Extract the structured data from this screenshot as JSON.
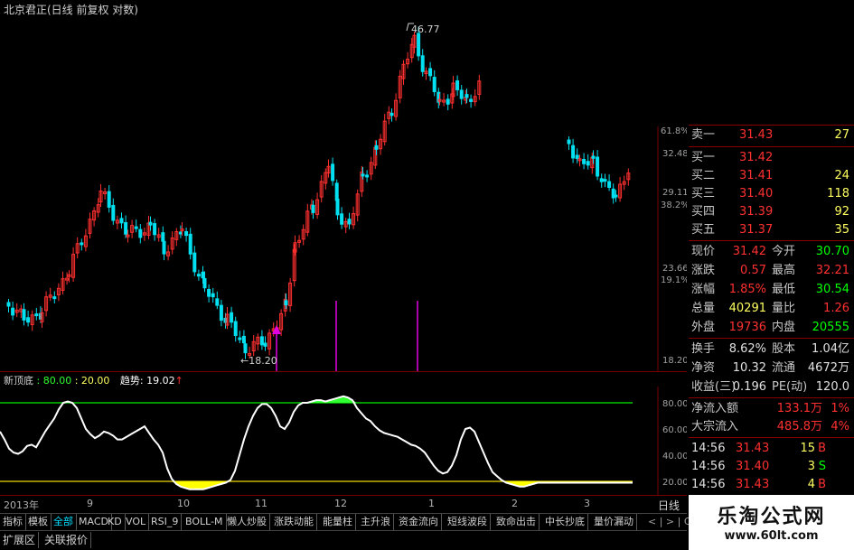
{
  "window": {
    "title": "北京君正(日线 前复权 对数)"
  },
  "price_chart": {
    "peak_label": "46.77",
    "low_label": "←18.20",
    "axis_labels": [
      "61.8%",
      "32.48",
      "29.11",
      "38.2%",
      "23.66",
      "19.1%",
      "18.20"
    ],
    "colors": {
      "up": "#ff3030",
      "down": "#00e0f0",
      "arrow": "#e000e0"
    }
  },
  "indicator": {
    "name": "新顶底",
    "line1": ": 80.00",
    "line2": ": 20.00",
    "trend_label": "趋势: 19.02",
    "trend_arrow": "↑",
    "axis_labels": [
      "80.00",
      "60.00",
      "40.00",
      "20.00"
    ],
    "colors": {
      "top_fill": "#30ff30",
      "bottom_fill": "#ffff00",
      "upper_line": "#00c800",
      "lower_line": "#c8b400"
    }
  },
  "time_axis": {
    "labels": [
      "2013年",
      "9",
      "10",
      "11",
      "12",
      "1",
      "2",
      "3"
    ]
  },
  "chart_data": {
    "type": "line",
    "x": [
      0,
      5,
      10,
      15,
      20,
      25,
      30,
      35,
      40,
      45,
      50,
      55,
      60,
      65,
      70,
      75,
      80,
      85,
      90,
      95,
      100,
      105,
      110,
      115,
      120,
      125,
      130,
      135,
      140,
      145,
      150,
      155,
      160,
      165,
      170,
      175,
      180,
      185,
      190,
      195,
      200,
      205,
      210,
      215,
      220,
      225,
      230,
      235,
      240,
      245,
      250,
      255,
      260,
      265,
      270,
      275,
      280,
      285,
      290,
      295,
      300,
      305,
      310,
      315,
      320,
      325,
      330,
      335,
      340,
      345,
      350,
      355,
      360,
      365,
      370,
      375,
      380,
      385,
      390,
      395,
      400,
      405,
      410,
      415,
      420,
      425,
      430,
      435,
      440,
      445,
      450,
      455,
      460,
      465,
      470,
      475,
      480,
      485,
      490,
      495,
      500,
      505,
      510,
      515,
      520,
      525,
      530,
      535,
      540,
      545,
      550,
      555,
      560,
      565,
      570,
      575,
      580,
      585,
      590,
      595,
      600,
      605,
      610,
      615,
      620,
      625,
      630,
      635,
      640,
      645,
      650,
      655,
      660,
      665,
      670,
      675,
      680,
      685,
      690,
      695,
      700
    ],
    "values": [
      58,
      52,
      45,
      42,
      41,
      43,
      47,
      48,
      46,
      52,
      58,
      63,
      68,
      75,
      80,
      81,
      80,
      76,
      68,
      60,
      56,
      53,
      55,
      58,
      57,
      55,
      52,
      52,
      54,
      56,
      58,
      60,
      62,
      57,
      52,
      48,
      42,
      30,
      22,
      18,
      16,
      15,
      14,
      14,
      14,
      14,
      15,
      16,
      17,
      18,
      19,
      21,
      28,
      40,
      52,
      62,
      70,
      76,
      79,
      79,
      76,
      70,
      62,
      60,
      65,
      73,
      78,
      80,
      80,
      81,
      82,
      82,
      81,
      82,
      83,
      84,
      85,
      84,
      82,
      76,
      72,
      68,
      66,
      62,
      59,
      57,
      56,
      55,
      54,
      52,
      50,
      48,
      47,
      45,
      42,
      37,
      32,
      28,
      26,
      27,
      32,
      40,
      52,
      60,
      61,
      58,
      50,
      42,
      34,
      27,
      24,
      21,
      19,
      18,
      17,
      16,
      16,
      17,
      18,
      19,
      19,
      19,
      19,
      19,
      19,
      19,
      19,
      19,
      19,
      19,
      19,
      19,
      19,
      19,
      19,
      19,
      19,
      19,
      19,
      19,
      19
    ],
    "xlabel": "",
    "ylabel": "",
    "ylim": [
      10,
      90
    ]
  },
  "quote_panel": {
    "sell_rows": [
      {
        "label": "卖一",
        "price": "31.43",
        "vol": "27"
      }
    ],
    "buy_rows": [
      {
        "label": "买一",
        "price": "31.42",
        "vol": ""
      },
      {
        "label": "买二",
        "price": "31.41",
        "vol": "24"
      },
      {
        "label": "买三",
        "price": "31.40",
        "vol": "118"
      },
      {
        "label": "买四",
        "price": "31.39",
        "vol": "92"
      },
      {
        "label": "买五",
        "price": "31.37",
        "vol": "35"
      }
    ],
    "stats": [
      {
        "l1": "现价",
        "v1": "31.42",
        "c1": "#ff3030",
        "l2": "今开",
        "v2": "30.70",
        "c2": "#00ff00"
      },
      {
        "l1": "涨跌",
        "v1": "0.57",
        "c1": "#ff3030",
        "l2": "最高",
        "v2": "32.21",
        "c2": "#ff3030"
      },
      {
        "l1": "涨幅",
        "v1": "1.85%",
        "c1": "#ff3030",
        "l2": "最低",
        "v2": "30.54",
        "c2": "#00ff00"
      },
      {
        "l1": "总量",
        "v1": "40291",
        "c1": "#ffff60",
        "l2": "量比",
        "v2": "1.26",
        "c2": "#ff3030"
      },
      {
        "l1": "外盘",
        "v1": "19736",
        "c1": "#ff3030",
        "l2": "内盘",
        "v2": "20555",
        "c2": "#00ff00"
      }
    ],
    "stats2": [
      {
        "l1": "换手",
        "v1": "8.62%",
        "l2": "股本",
        "v2": "1.04亿"
      },
      {
        "l1": "净资",
        "v1": "10.32",
        "l2": "流通",
        "v2": "4672万"
      },
      {
        "l1": "收益(三)",
        "v1": "0.196",
        "l2": "PE(动)",
        "v2": "120.0"
      }
    ],
    "flows": [
      {
        "label": "净流入额",
        "value": "133.1万",
        "pct": "1%"
      },
      {
        "label": "大宗流入",
        "value": "485.8万",
        "pct": "4%"
      }
    ],
    "ticks": [
      {
        "time": "14:56",
        "price": "31.43",
        "price_color": "#ff3030",
        "vol": "15",
        "side": "B",
        "side_color": "#ff3030"
      },
      {
        "time": "14:56",
        "price": "31.40",
        "price_color": "#ff3030",
        "vol": "3",
        "side": "S",
        "side_color": "#00ff00"
      },
      {
        "time": "14:56",
        "price": "31.43",
        "price_color": "#ff3030",
        "vol": "4",
        "side": "B",
        "side_color": "#ff3030"
      }
    ],
    "period_tab": "日线"
  },
  "tabs": {
    "row1": [
      "指标",
      "模板",
      "全部",
      "MACD",
      "KD",
      "VOL",
      "RSI_9",
      "BOLL-M",
      "懒人炒股",
      "涨跌动能",
      "能量柱",
      "主升浪",
      "资金流向",
      "短线波段",
      "致命出击",
      "中长抄底",
      "量价漏动"
    ],
    "row1_active": 2,
    "row1_tail": "< | > | C",
    "row2": [
      "扩展区",
      "关联报价"
    ]
  },
  "watermark": {
    "title": "乐淘公式网",
    "url": "www.60lt.com"
  }
}
